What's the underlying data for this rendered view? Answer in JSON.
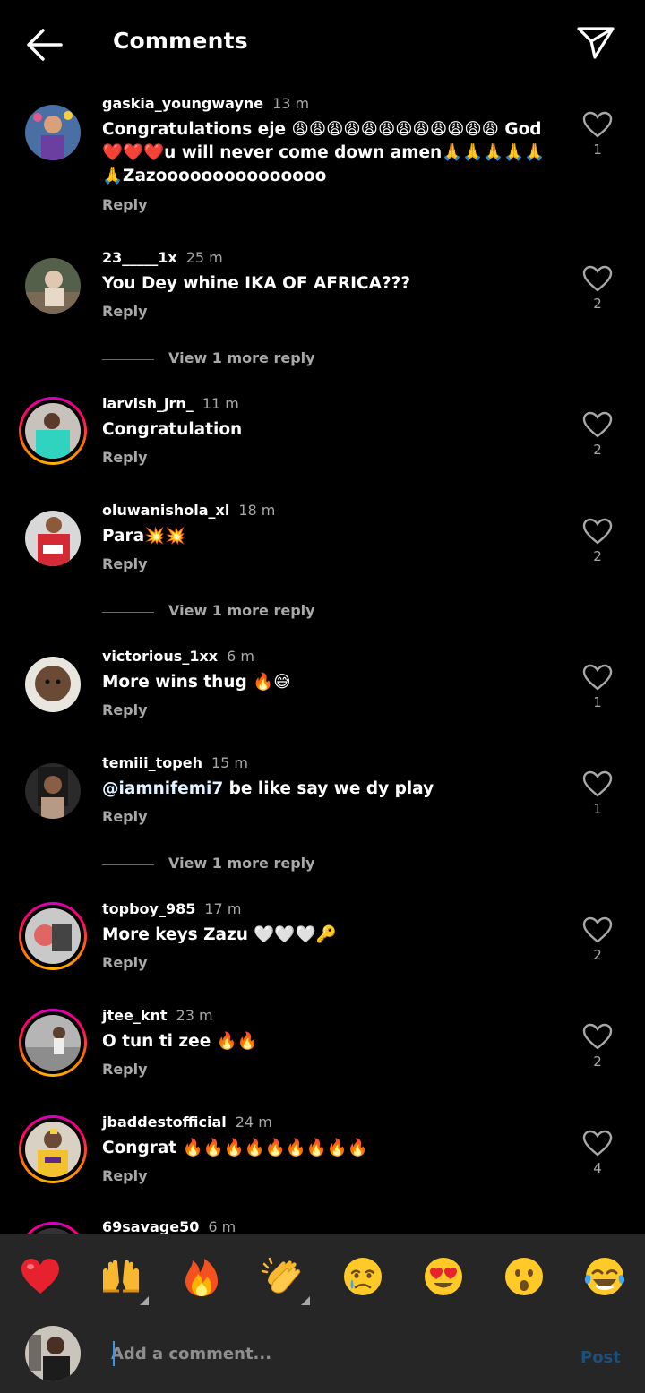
{
  "header": {
    "title": "Comments",
    "back_icon": "arrow-left-icon",
    "send_icon": "paper-plane-icon"
  },
  "comments": [
    {
      "username": "gaskia_youngwayne",
      "time": "13 m",
      "text": "Congratulations eje 😩😩😩😩😩😩😩😩😩😩😩😩 God ❤️❤️❤️u will never come down amen🙏🙏🙏🙏🙏🙏Zazooooooooooooooo",
      "reply": "Reply",
      "likes": "1"
    },
    {
      "username": "23_____1x",
      "time": "25 m",
      "text": "You Dey whine IKA OF AFRICA???",
      "reply": "Reply",
      "likes": "2"
    },
    {
      "username": "larvish_jrn_",
      "time": "11 m",
      "text": "Congratulation",
      "reply": "Reply",
      "likes": "2"
    },
    {
      "username": "oluwanishola_xl",
      "time": "18 m",
      "text": "Para💥💥",
      "reply": "Reply",
      "likes": "2"
    },
    {
      "username": "victorious_1xx",
      "time": "6 m",
      "text": "More wins thug 🔥😅",
      "reply": "Reply",
      "likes": "1"
    },
    {
      "username": "temiii_topeh",
      "time": "15 m",
      "mention": "@iamnifemi7",
      "text": " be like say we dy play",
      "reply": "Reply",
      "likes": "1"
    },
    {
      "username": "topboy_985",
      "time": "17 m",
      "text": "More keys Zazu 🤍🤍🤍🔑",
      "reply": "Reply",
      "likes": "2"
    },
    {
      "username": "jtee_knt",
      "time": "23 m",
      "text": "O tun ti zee 🔥🔥",
      "reply": "Reply",
      "likes": "2"
    },
    {
      "username": "jbaddestofficial",
      "time": "24 m",
      "text": "Congrat 🔥🔥🔥🔥🔥🔥🔥🔥🔥",
      "reply": "Reply",
      "likes": "4"
    },
    {
      "username": "69savage50",
      "time": "6 m"
    }
  ],
  "view_more": [
    "View 1 more reply",
    "View 1 more reply",
    "View 1 more reply"
  ],
  "reactions": [
    {
      "icon": "red-heart-icon"
    },
    {
      "icon": "raising-hands-icon"
    },
    {
      "icon": "fire-icon"
    },
    {
      "icon": "clapping-hands-icon"
    },
    {
      "icon": "crying-face-icon"
    },
    {
      "icon": "heart-eyes-icon"
    },
    {
      "icon": "surprised-face-icon"
    },
    {
      "icon": "tears-of-joy-icon"
    }
  ],
  "composer": {
    "placeholder": "Add a comment...",
    "post_label": "Post"
  },
  "colors": {
    "background": "#000000",
    "composer_bg": "#262626",
    "secondary_text": "#a8a8a8",
    "post_disabled": "#1f4e79"
  }
}
